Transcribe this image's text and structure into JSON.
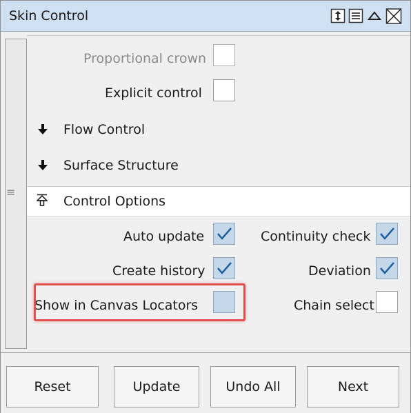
{
  "window": {
    "title": "Skin Control",
    "icons": [
      "updown-arrows-icon",
      "list-menu-icon",
      "collapse-triangle-icon",
      "close-box-icon"
    ]
  },
  "options_top": [
    {
      "label": "Proportional crown",
      "checked": false,
      "disabled": true
    },
    {
      "label": "Explicit control",
      "checked": false,
      "disabled": false
    }
  ],
  "sections": [
    {
      "label": "Flow Control",
      "icon": "expand-down-arrow-icon"
    },
    {
      "label": "Surface Structure",
      "icon": "expand-down-arrow-icon"
    },
    {
      "label": "Control Options",
      "icon": "collapse-up-arrow-icon"
    }
  ],
  "control_options": {
    "auto_update": {
      "label": "Auto update",
      "checked": true
    },
    "continuity_check": {
      "label": "Continuity check",
      "checked": true
    },
    "create_history": {
      "label": "Create history",
      "checked": true
    },
    "deviation": {
      "label": "Deviation",
      "checked": true
    },
    "show_in_canvas_locators": {
      "label": "Show in Canvas Locators",
      "checked": false,
      "highlighted": true
    },
    "chain_select": {
      "label": "Chain select",
      "checked": false
    }
  },
  "buttons": {
    "reset": "Reset",
    "update": "Update",
    "undo_all": "Undo All",
    "next": "Next"
  },
  "colors": {
    "titlebar": "#cfe0f2",
    "checkbox_checked_bg": "#c5d8ea",
    "checkmark": "#1f5f9f",
    "highlight": "#e2514d"
  }
}
